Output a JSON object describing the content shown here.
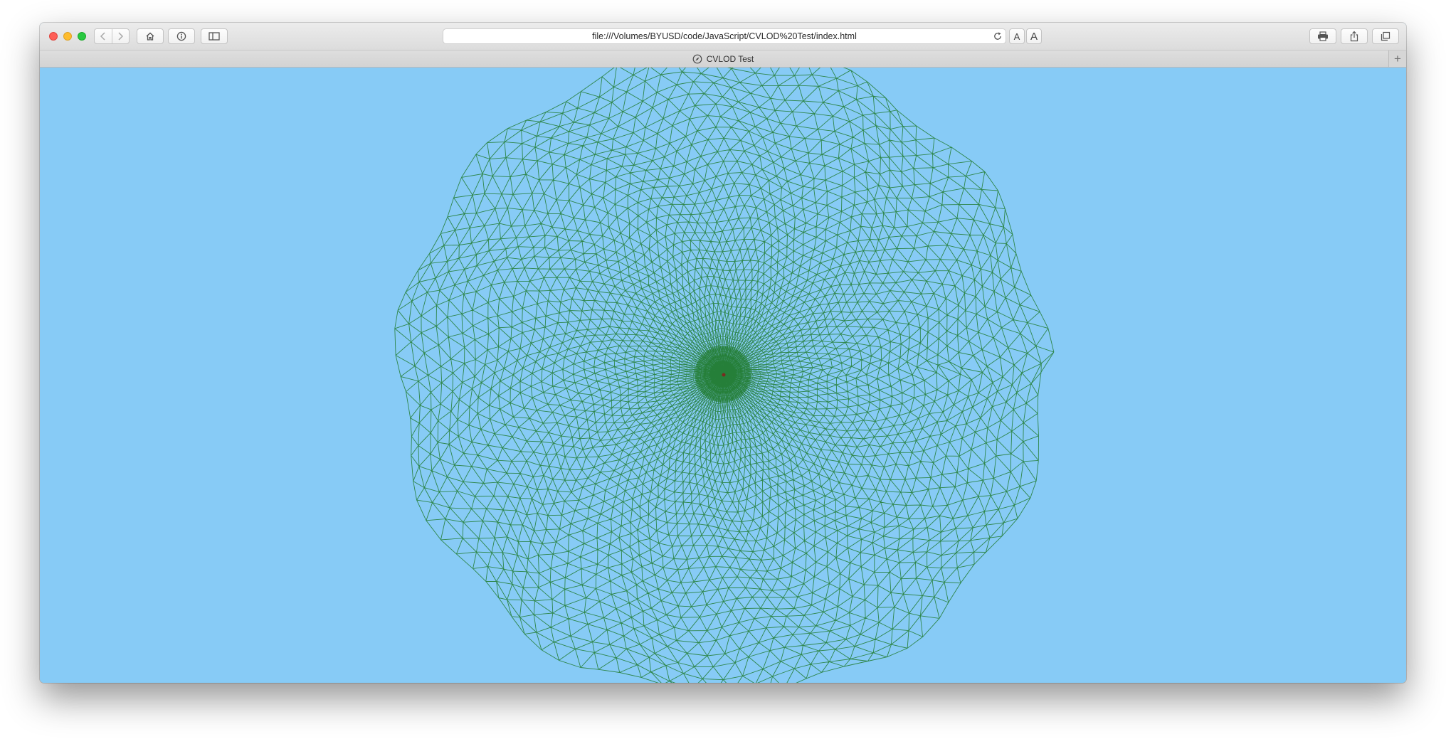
{
  "browser": {
    "address": "file:///Volumes/BYUSD/code/JavaScript/CVLOD%20Test/index.html",
    "font_smaller": "A",
    "font_larger": "A"
  },
  "tab": {
    "title": "CVLOD Test",
    "new_tab": "+"
  },
  "scene": {
    "background": "#87cbf6",
    "mesh_color": "#1f7a2c",
    "description_icon": "compass-icon"
  }
}
